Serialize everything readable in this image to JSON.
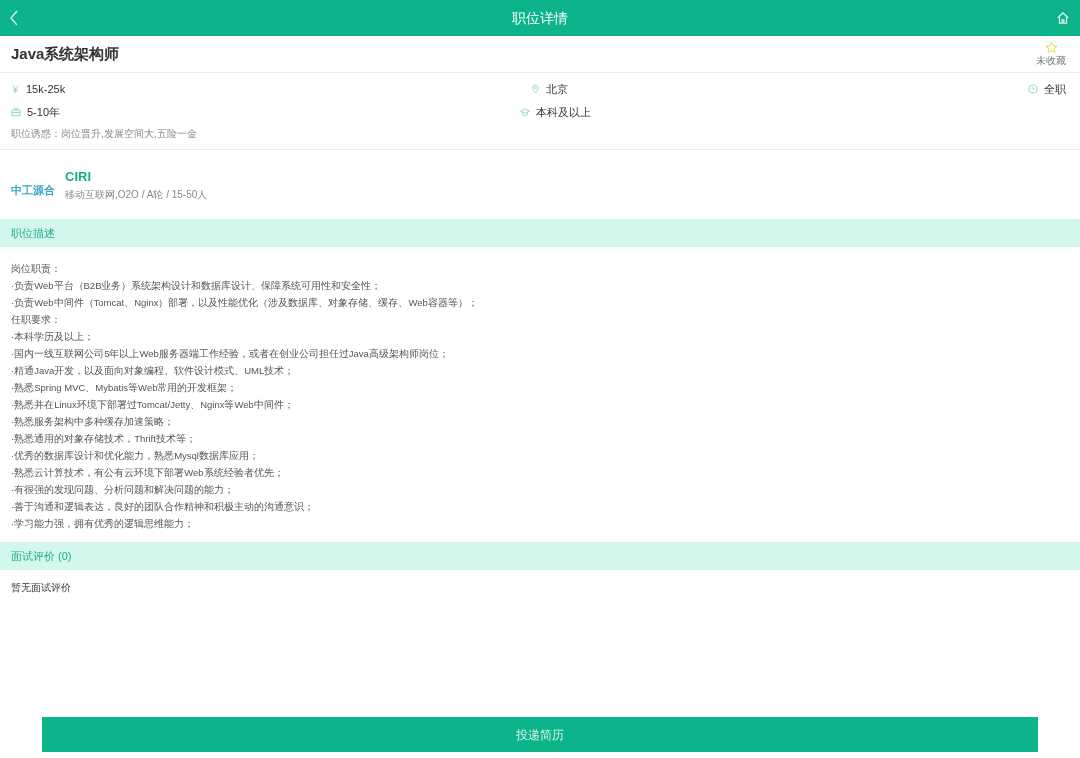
{
  "header": {
    "title": "职位详情"
  },
  "job": {
    "title": "Java系统架构师",
    "favorite": {
      "label": "未收藏",
      "selected": false
    }
  },
  "info": {
    "salary": "15k-25k",
    "location": "北京",
    "type": "全职",
    "experience": "5-10年",
    "education": "本科及以上",
    "perks": "职位诱惑：岗位晋升,发展空间大,五险一金"
  },
  "company": {
    "logo": "中工源合",
    "name": "CIRI",
    "details": "移动互联网,O2O / A轮 / 15-50人"
  },
  "description": {
    "heading": "职位描述",
    "lines": [
      "岗位职责：",
      "·负责Web平台（B2B业务）系统架构设计和数据库设计、保障系统可用性和安全性；",
      "·负责Web中间件（Tomcat、Nginx）部署，以及性能优化（涉及数据库、对象存储、缓存、Web容器等）；",
      "任职要求：",
      "·本科学历及以上；",
      "·国内一线互联网公司5年以上Web服务器端工作经验，或者在创业公司担任过Java高级架构师岗位；",
      "·精通Java开发，以及面向对象编程、软件设计模式、UML技术；",
      "·熟悉Spring MVC、Mybatis等Web常用的开发框架；",
      "·熟悉并在Linux环境下部署过Tomcat/Jetty、Nginx等Web中间件；",
      "·熟悉服务架构中多种缓存加速策略；",
      "·熟悉通用的对象存储技术，Thrift技术等；",
      "·优秀的数据库设计和优化能力，熟悉Mysql数据库应用；",
      "·熟悉云计算技术，有公有云环境下部署Web系统经验者优先；",
      "·有很强的发现问题、分析问题和解决问题的能力；",
      "·善于沟通和逻辑表达，良好的团队合作精神和积极主动的沟通意识；",
      "·学习能力强，拥有优秀的逻辑思维能力；"
    ]
  },
  "reviews": {
    "heading": "面试评价 (0)",
    "empty": "暂无面试评价"
  },
  "apply_button": "投递简历"
}
